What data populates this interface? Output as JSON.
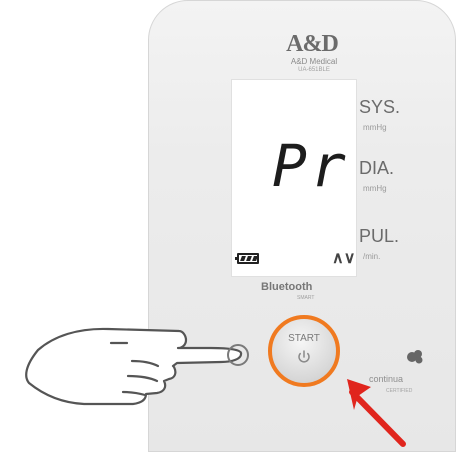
{
  "device": {
    "brand": "A&D",
    "subtitle": "A&D Medical",
    "model": "UA-651BLE"
  },
  "display": {
    "text": "Pr",
    "arrows": "∧∨",
    "battery": "full"
  },
  "labels": {
    "sys": "SYS.",
    "sys_unit": "mmHg",
    "dia": "DIA.",
    "dia_unit": "mmHg",
    "pul": "PUL.",
    "pul_unit": "/min."
  },
  "bluetooth": {
    "label": "Bluetooth",
    "sub": "SMART"
  },
  "start_button": {
    "label": "START"
  },
  "continua": {
    "label": "continua",
    "sub": "CERTIFIED"
  },
  "colors": {
    "highlight": "#f07a20",
    "arrow": "#e0251d",
    "display_text": "#1d1d1d"
  },
  "icons": {
    "power": "power-icon",
    "finger": "finger-icon",
    "arrow": "pointer-arrow-icon",
    "continua": "continua-icon"
  }
}
